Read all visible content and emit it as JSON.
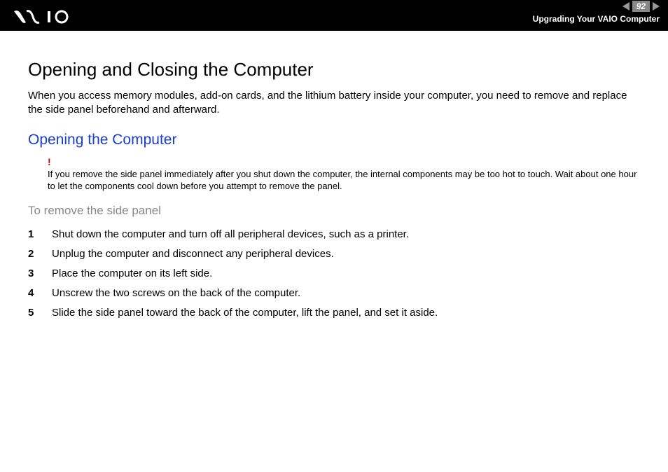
{
  "header": {
    "page_num": "92",
    "section": "Upgrading Your VAIO Computer"
  },
  "main": {
    "title": "Opening and Closing the Computer",
    "intro": "When you access memory modules, add-on cards, and the lithium battery inside your computer, you need to remove and replace the side panel beforehand and afterward.",
    "subheading": "Opening the Computer",
    "warning_mark": "!",
    "warning": "If you remove the side panel immediately after you shut down the computer, the internal components may be too hot to touch. Wait about one hour to let the components cool down before you attempt to remove the panel.",
    "procedure_title": "To remove the side panel",
    "steps": [
      {
        "n": "1",
        "t": "Shut down the computer and turn off all peripheral devices, such as a printer."
      },
      {
        "n": "2",
        "t": "Unplug the computer and disconnect any peripheral devices."
      },
      {
        "n": "3",
        "t": "Place the computer on its left side."
      },
      {
        "n": "4",
        "t": "Unscrew the two screws on the back of the computer."
      },
      {
        "n": "5",
        "t": "Slide the side panel toward the back of the computer, lift the panel, and set it aside."
      }
    ]
  }
}
